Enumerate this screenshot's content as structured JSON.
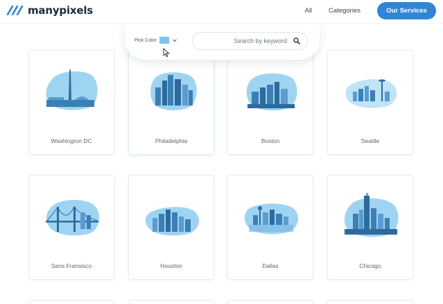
{
  "brand": {
    "name": "manypixels",
    "color": "#1e2a3b"
  },
  "nav": {
    "all": "All",
    "categories": "Categories",
    "cta": "Our Services",
    "accent": "#2f86d6"
  },
  "filter": {
    "pick_color_label": "Pick Color",
    "selected_color": "#7cc4ee",
    "search_placeholder": "Search by keyword"
  },
  "cards": [
    {
      "label": "Washington DC"
    },
    {
      "label": "Philadelphia"
    },
    {
      "label": "Boston"
    },
    {
      "label": "Seattle"
    },
    {
      "label": "Sans Fransisco"
    },
    {
      "label": "Houston"
    },
    {
      "label": "Dallas"
    },
    {
      "label": "Chicago"
    }
  ],
  "icons": [
    "logo-stripes-icon",
    "chevron-down-icon",
    "search-icon",
    "mouse-cursor-icon"
  ]
}
